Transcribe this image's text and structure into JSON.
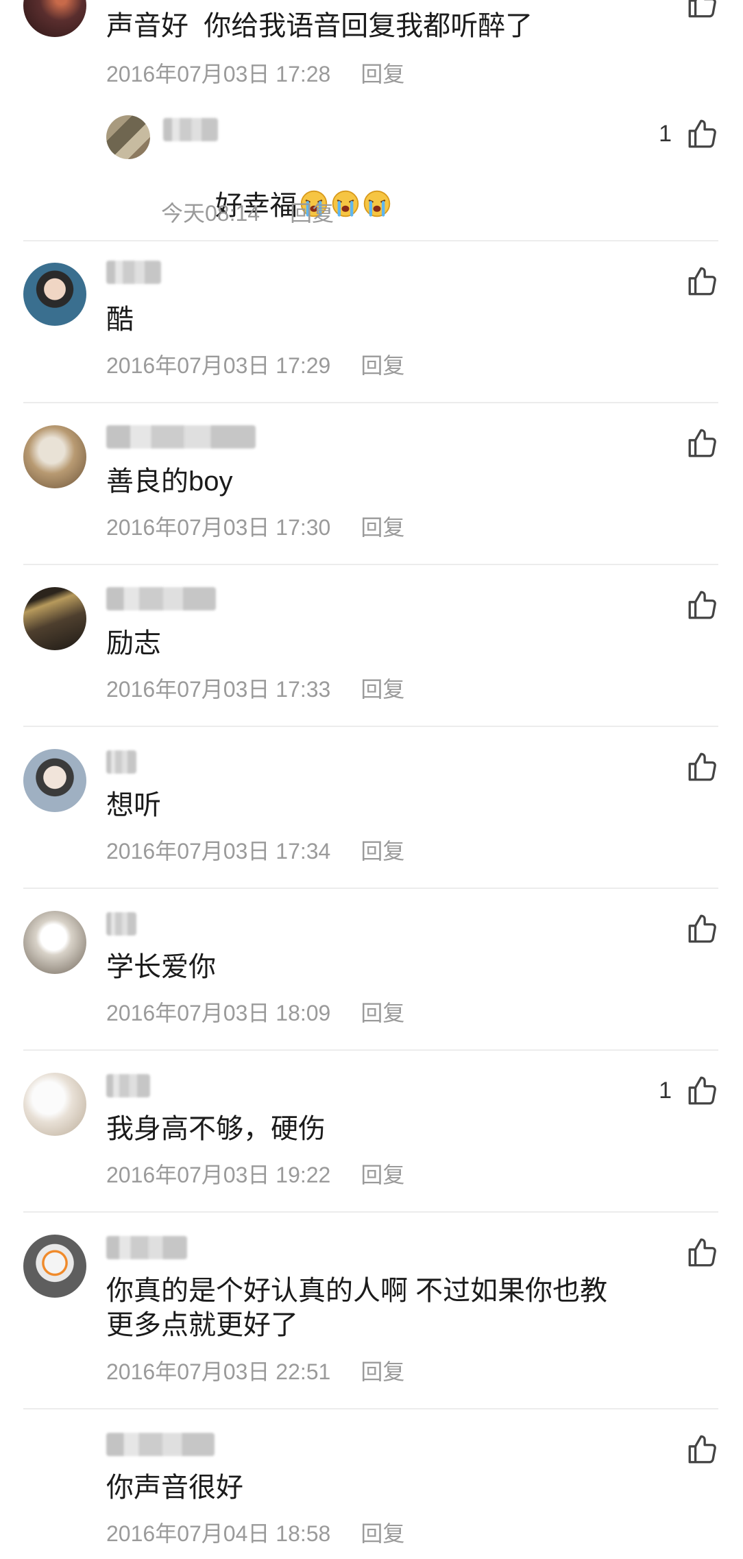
{
  "comments": [
    {
      "text": "声音好  你给我语音回复我都听醉了",
      "date": "2016年07月03日 17:28",
      "reply_label": "回复",
      "likes": "",
      "avatar_color": "#5a2e2e"
    },
    {
      "reply": true,
      "text": "好幸福",
      "emojis": [
        "crying-face",
        "crying-face",
        "crying-face"
      ],
      "date": "今天08:14",
      "reply_label": "回复",
      "likes": "1",
      "avatar_color": "#8c7a60"
    },
    {
      "text": "酷",
      "date": "2016年07月03日 17:29",
      "reply_label": "回复",
      "likes": "",
      "avatar_color": "#3a6f8f"
    },
    {
      "text": "善良的boy",
      "date": "2016年07月03日 17:30",
      "reply_label": "回复",
      "likes": "",
      "avatar_color": "#b89a72"
    },
    {
      "text": "励志",
      "date": "2016年07月03日 17:33",
      "reply_label": "回复",
      "likes": "",
      "avatar_color": "#4e3f2e"
    },
    {
      "text": "想听",
      "date": "2016年07月03日 17:34",
      "reply_label": "回复",
      "likes": "",
      "avatar_color": "#7a8a9c"
    },
    {
      "text": "学长爱你",
      "date": "2016年07月03日 18:09",
      "reply_label": "回复",
      "likes": "",
      "avatar_color": "#9c8c7a"
    },
    {
      "text": "我身高不够，硬伤",
      "date": "2016年07月03日 19:22",
      "reply_label": "回复",
      "likes": "1",
      "avatar_color": "#cfc2b4"
    },
    {
      "text": "你真的是个好认真的人啊 不过如果你也教\n更多点就更好了",
      "date": "2016年07月03日 22:51",
      "reply_label": "回复",
      "likes": "",
      "avatar_color": "#6e6e6e"
    },
    {
      "text": "你声音很好",
      "date": "2016年07月04日 18:58",
      "reply_label": "回复",
      "likes": "",
      "avatar_color": "#2e2e2e"
    }
  ],
  "colors": {
    "meta": "#9a9a9a",
    "divider": "#ececec",
    "text": "#1b1b1b"
  }
}
